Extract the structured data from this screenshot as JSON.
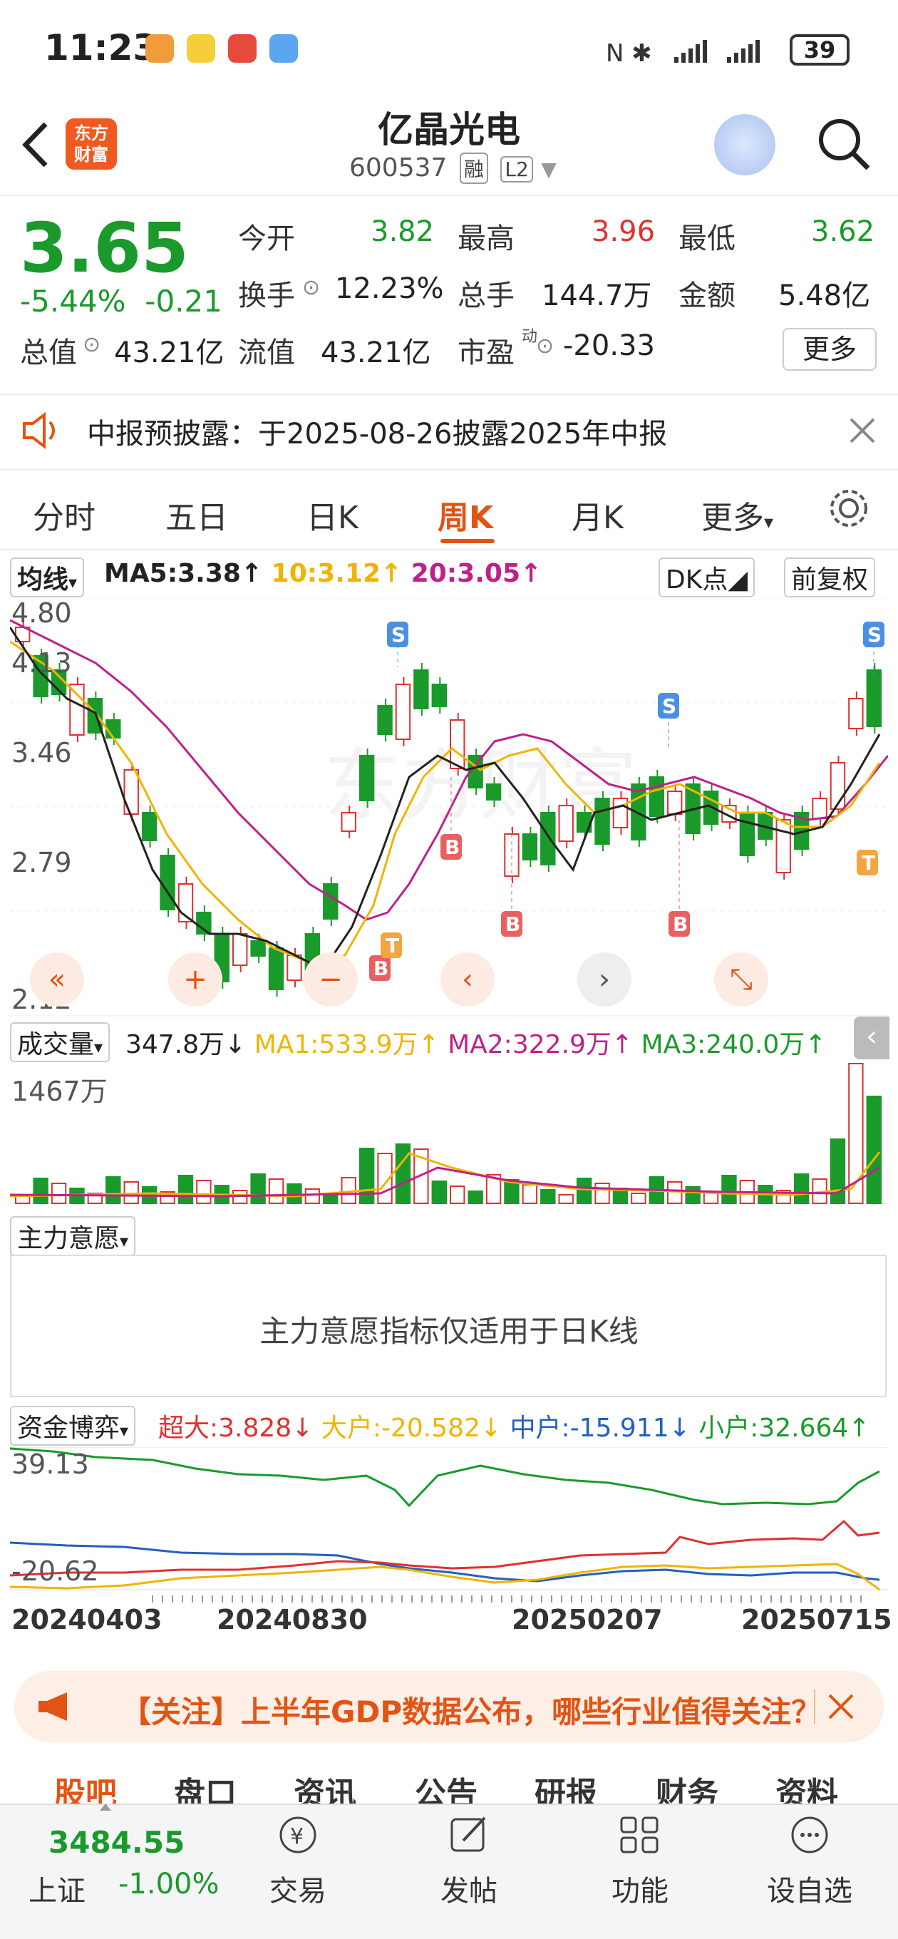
{
  "status_bar": {
    "time": "11:23",
    "battery": "39"
  },
  "header": {
    "logo_text": "东方\n财富",
    "stock_name": "亿晶光电",
    "stock_code": "600537",
    "tag_margin": "融",
    "tag_level": "L2"
  },
  "quote": {
    "price": "3.65",
    "change_pct": "-5.44%",
    "change_abs": "-0.21",
    "open_label": "今开",
    "open": "3.82",
    "high_label": "最高",
    "high": "3.96",
    "low_label": "最低",
    "low": "3.62",
    "turnover_label": "换手",
    "turnover": "12.23%",
    "volume_label": "总手",
    "volume": "144.7万",
    "amount_label": "金额",
    "amount": "5.48亿",
    "mcap_label": "总值",
    "mcap": "43.21亿",
    "float_label": "流值",
    "float": "43.21亿",
    "pe_label": "市盈",
    "pe_sup": "动",
    "pe": "-20.33",
    "more_label": "更多"
  },
  "notice": {
    "text": "中报预披露：于2025-08-26披露2025年中报"
  },
  "tabs": [
    "分时",
    "五日",
    "日K",
    "周K",
    "月K",
    "更多"
  ],
  "active_tab": "周K",
  "kline": {
    "indicator_label": "均线",
    "ma5": "MA5:3.38↑",
    "ma10": "10:3.12↑",
    "ma20": "20:3.05↑",
    "dk_label": "DK点",
    "fq_label": "前复权",
    "y_labels": [
      "4.80",
      "4.13",
      "3.46",
      "2.79",
      "2.12"
    ]
  },
  "volume": {
    "label": "成交量",
    "value": "347.8万↓",
    "ma1": "MA1:533.9万↑",
    "ma2": "MA2:322.9万↑",
    "ma3": "MA3:240.0万↑",
    "max_label": "1467万"
  },
  "zhuli": {
    "label": "主力意愿",
    "message": "主力意愿指标仅适用于日K线"
  },
  "zijin": {
    "label": "资金博弈",
    "super": "超大:3.828↓",
    "big": "大户:-20.582↓",
    "mid": "中户:-15.911↓",
    "small": "小户:32.664↑",
    "y_top": "39.13",
    "y_bottom": "-20.62"
  },
  "dates": [
    "20240403",
    "20240830",
    "20250207",
    "20250715"
  ],
  "banner": {
    "text": "【关注】上半年GDP数据公布，哪些行业值得关注？"
  },
  "bottom_tabs": [
    "股吧",
    "盘口",
    "资讯",
    "公告",
    "研报",
    "财务",
    "资料"
  ],
  "bottom_bar": {
    "index_value": "3484.55",
    "index_name": "上证",
    "index_change": "-1.00%",
    "items": [
      "交易",
      "发帖",
      "功能",
      "设自选"
    ]
  },
  "colors": {
    "accent": "#e25414",
    "up": "#e03030",
    "down": "#1a9a2b",
    "ma10": "#f0b400",
    "ma20": "#c0208a",
    "mid": "#2060c0"
  }
}
